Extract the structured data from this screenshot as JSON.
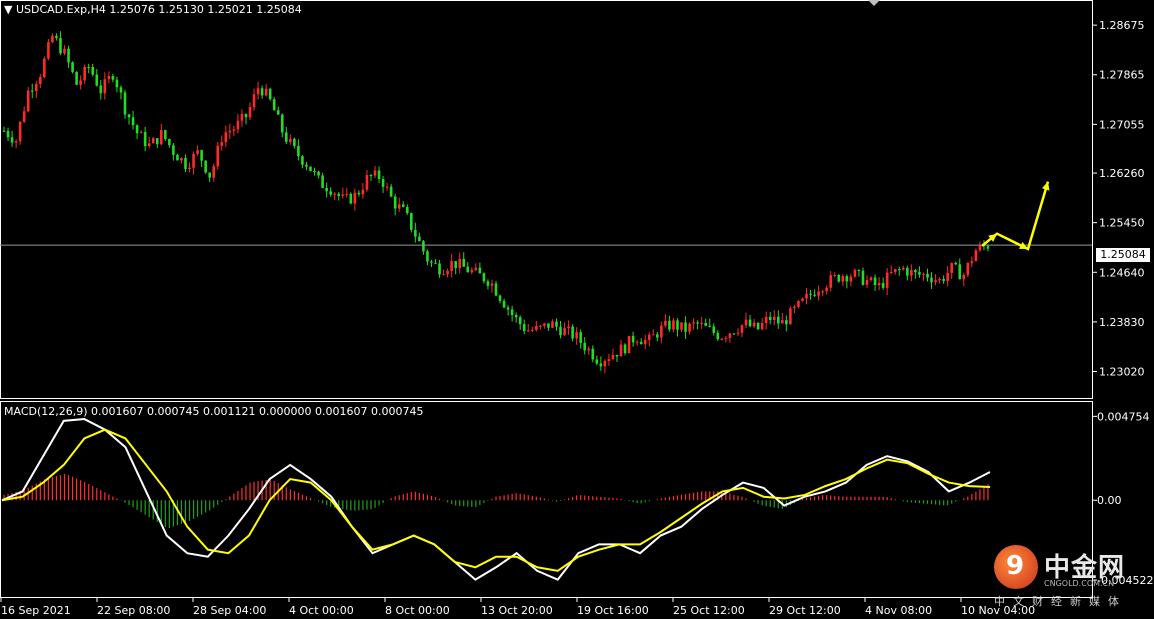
{
  "header": {
    "symbol_line": "USDCAD.Exp,H4  1.25076 1.25130 1.25021 1.25084",
    "macd_line": "MACD(12,26,9) 0.001607 0.000745 0.001121 0.000000 0.001607 0.000745",
    "current_price_label": "1.25084"
  },
  "colors": {
    "background": "#000000",
    "bull_candle": "#ff2a2a",
    "bear_candle": "#22dd22",
    "macd_line": "#ffffff",
    "signal_line": "#ffff00",
    "hist_up": "#ff3030",
    "hist_down": "#20a020",
    "grid_border": "#ffffff",
    "arrow": "#ffff00"
  },
  "chart_data": [
    {
      "type": "candlestick",
      "title": "USDCAD.Exp,H4",
      "ohlc_current": {
        "open": 1.25076,
        "high": 1.2513,
        "low": 1.25021,
        "close": 1.25084
      },
      "ylim": [
        1.2262,
        1.2902
      ],
      "y_ticks": [
        "1.28675",
        "1.27865",
        "1.27055",
        "1.26260",
        "1.25450",
        "1.24640",
        "1.23830",
        "1.23020"
      ],
      "y_tick_values": [
        1.28675,
        1.27865,
        1.27055,
        1.2626,
        1.2545,
        1.2464,
        1.2383,
        1.2302
      ],
      "x_ticks": [
        "16 Sep 2021",
        "22 Sep 08:00",
        "28 Sep 04:00",
        "4 Oct 00:00",
        "8 Oct 00:00",
        "13 Oct 20:00",
        "19 Oct 16:00",
        "25 Oct 12:00",
        "29 Oct 12:00",
        "4 Nov 08:00",
        "10 Nov 04:00"
      ],
      "current_price": 1.25084,
      "close_path": [
        1.2695,
        1.268,
        1.276,
        1.279,
        1.285,
        1.282,
        1.277,
        1.28,
        1.276,
        1.279,
        1.273,
        1.269,
        1.267,
        1.269,
        1.266,
        1.264,
        1.266,
        1.262,
        1.269,
        1.27,
        1.272,
        1.277,
        1.274,
        1.269,
        1.266,
        1.264,
        1.261,
        1.26,
        1.258,
        1.259,
        1.262,
        1.262,
        1.258,
        1.256,
        1.252,
        1.248,
        1.247,
        1.248,
        1.247,
        1.246,
        1.245,
        1.242,
        1.239,
        1.237,
        1.237,
        1.238,
        1.237,
        1.236,
        1.234,
        1.232,
        1.233,
        1.234,
        1.236,
        1.235,
        1.237,
        1.238,
        1.237,
        1.238,
        1.237,
        1.236,
        1.237,
        1.238,
        1.237,
        1.239,
        1.238,
        1.24,
        1.242,
        1.244,
        1.245,
        1.246,
        1.246,
        1.245,
        1.244,
        1.246,
        1.247,
        1.246,
        1.246,
        1.245,
        1.247,
        1.246,
        1.25,
        1.25084
      ],
      "annotation": {
        "type": "forecast-arrow",
        "points": [
          1.2507,
          1.2527,
          1.2502,
          1.2612
        ]
      }
    },
    {
      "type": "macd",
      "title": "MACD(12,26,9)",
      "params": [
        12,
        26,
        9
      ],
      "values_current": [
        0.001607,
        0.000745,
        0.001121,
        0.0,
        0.001607,
        0.000745
      ],
      "ylim": [
        -0.0052,
        0.005
      ],
      "y_ticks": [
        "0.004754",
        "0.00",
        "-0.004522"
      ],
      "y_tick_values": [
        0.004754,
        0.0,
        -0.004522
      ],
      "macd": [
        0,
        0.0005,
        0.0025,
        0.0045,
        0.0046,
        0.004,
        0.003,
        0.0005,
        -0.002,
        -0.003,
        -0.0032,
        -0.002,
        -0.0005,
        0.0012,
        0.002,
        0.0012,
        0.0002,
        -0.0015,
        -0.003,
        -0.0025,
        -0.002,
        -0.0025,
        -0.0035,
        -0.0045,
        -0.0038,
        -0.003,
        -0.004,
        -0.0045,
        -0.003,
        -0.0025,
        -0.0025,
        -0.003,
        -0.002,
        -0.0015,
        -0.0005,
        0.0003,
        0.001,
        0.0007,
        -0.0003,
        0.0002,
        0.0005,
        0.001,
        0.002,
        0.0025,
        0.0022,
        0.0016,
        0.0005,
        0.001,
        0.0016
      ],
      "signal": [
        0,
        0.0002,
        0.001,
        0.002,
        0.0035,
        0.004,
        0.0035,
        0.002,
        0.0005,
        -0.0015,
        -0.0028,
        -0.003,
        -0.002,
        0.0,
        0.0012,
        0.001,
        0.0,
        -0.0015,
        -0.0028,
        -0.0025,
        -0.002,
        -0.0025,
        -0.0035,
        -0.0038,
        -0.0032,
        -0.0032,
        -0.0038,
        -0.004,
        -0.0032,
        -0.0028,
        -0.0025,
        -0.0025,
        -0.0018,
        -0.001,
        -0.0002,
        0.0005,
        0.0007,
        0.0002,
        0.0001,
        0.0003,
        0.0008,
        0.0012,
        0.0018,
        0.0023,
        0.0021,
        0.0015,
        0.001,
        0.0008,
        0.00075
      ],
      "histogram": [
        0.0003,
        0.0006,
        0.0012,
        0.0015,
        0.001,
        0.0004,
        -0.0002,
        -0.0009,
        -0.0016,
        -0.0012,
        -0.0006,
        0.0002,
        0.001,
        0.0012,
        0.0006,
        0.0001,
        -0.0004,
        -0.0006,
        -0.0005,
        0.0002,
        0.0005,
        0.0002,
        -0.0003,
        -0.0004,
        0.0002,
        0.0004,
        0.0002,
        -0.0001,
        0.0003,
        0.0002,
        0.0001,
        -0.0002,
        0.0001,
        0.0003,
        0.0005,
        0.0005,
        0.0002,
        -0.0003,
        -0.0005,
        0.0001,
        0.0003,
        0.0002,
        0.0002,
        0.0002,
        -0.0001,
        -0.0002,
        -0.0003,
        0.0002,
        0.0009
      ]
    }
  ],
  "watermark": {
    "logo_glyph": "9",
    "name": "中金网",
    "site": "CNGOLD.COM.CN",
    "sub": "中文财经新媒体"
  }
}
